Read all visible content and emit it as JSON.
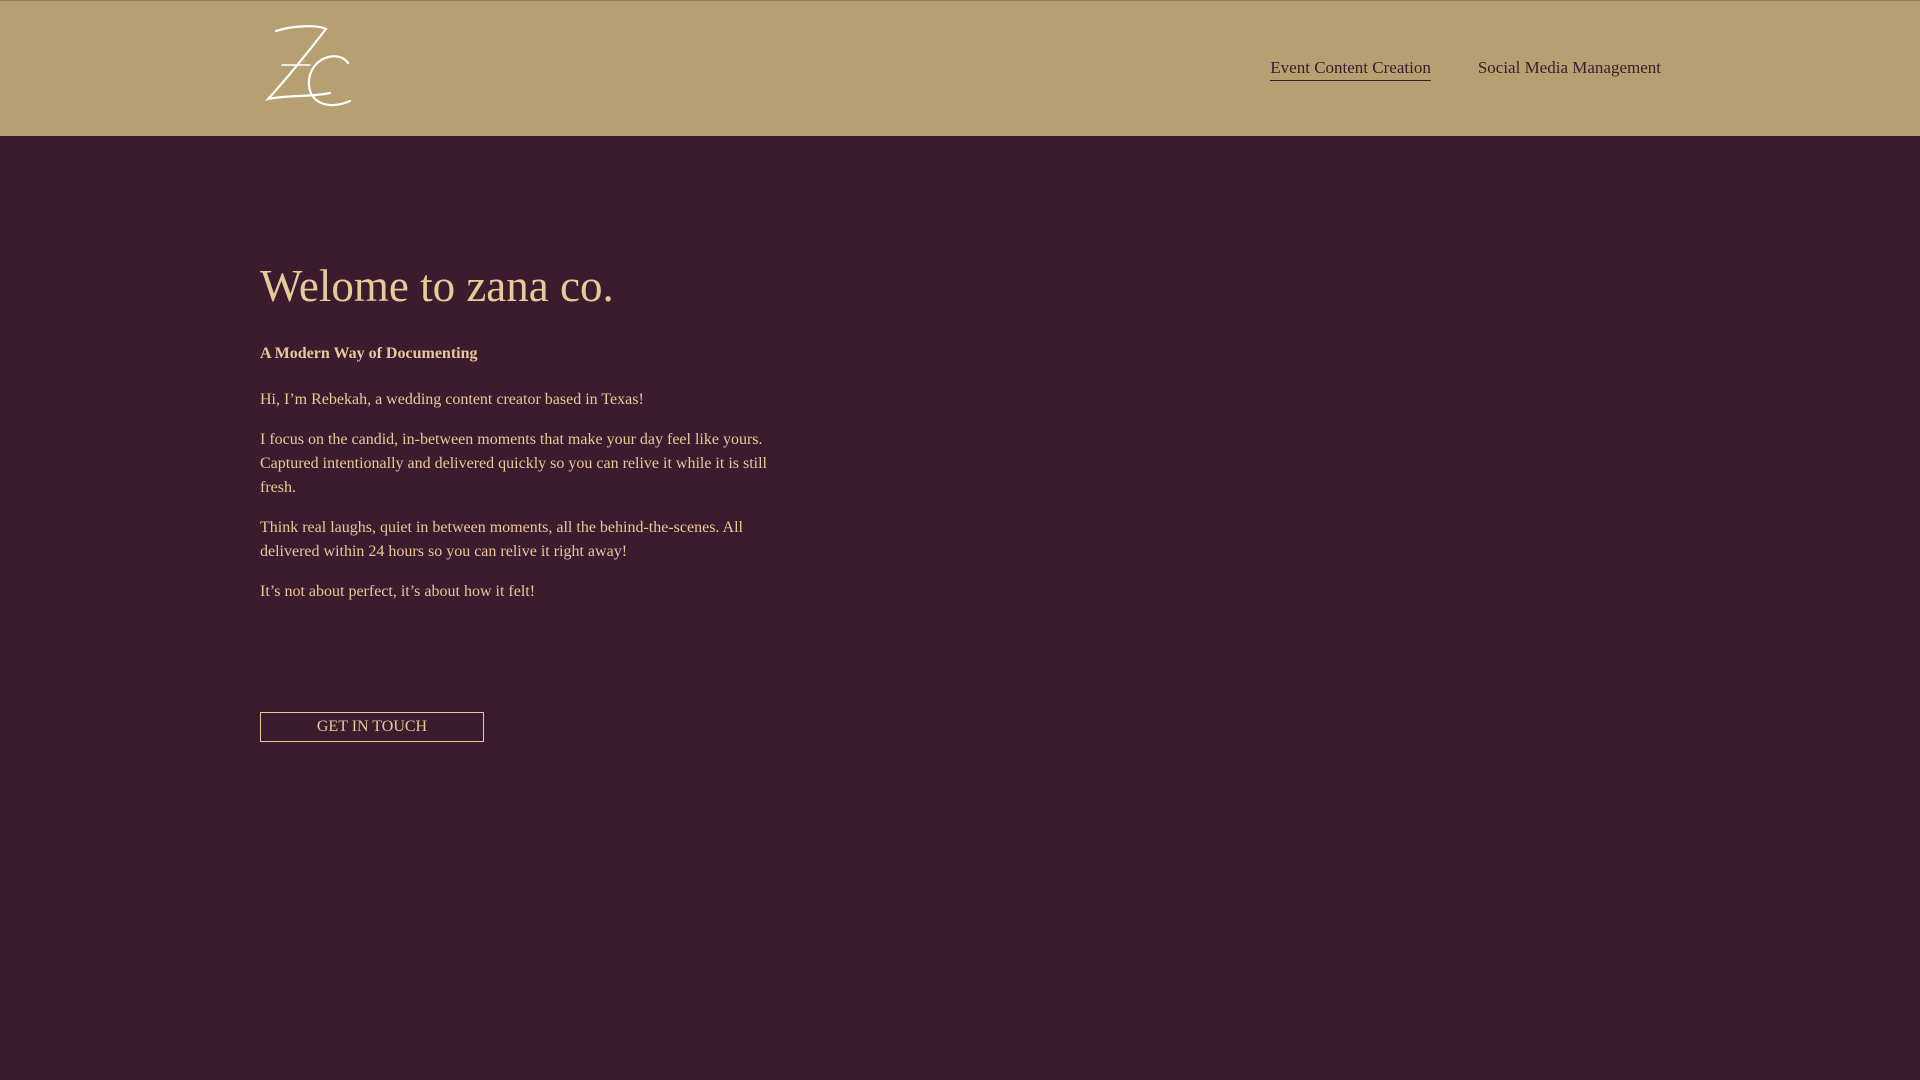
{
  "header": {
    "logo_alt": "ZC logo",
    "nav": [
      {
        "label": "Event Content Creation",
        "active": true
      },
      {
        "label": "Social Media Management",
        "active": false
      }
    ]
  },
  "hero": {
    "title": "Welome to zana co.",
    "subtitle": "A Modern Way of Documenting",
    "paragraphs": [
      "Hi, I’m Rebekah, a wedding content creator based in Texas!",
      "I focus on the candid, in-between moments that make your day feel like yours. Captured intentionally and delivered quickly so you can relive it while it is still fresh.",
      "Think real laughs, quiet in between moments, all the behind-the-scenes. All delivered within 24 hours so you can relive it right away!",
      "It’s not about perfect, it’s about how it felt!"
    ],
    "cta_label": "GET IN TOUCH"
  },
  "colors": {
    "header_bg": "#b6a072",
    "page_bg": "#3a1c2e",
    "accent_text": "#e8c998",
    "nav_text": "#3a1c2e"
  }
}
